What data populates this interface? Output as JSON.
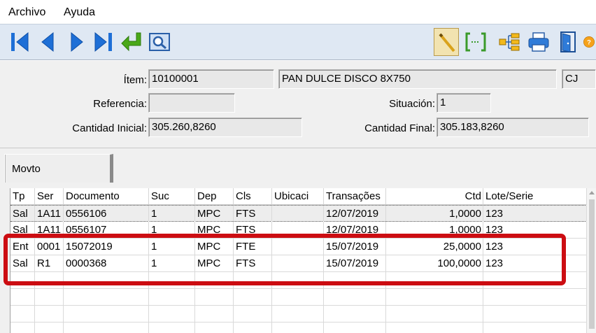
{
  "menu": {
    "archivo": "Archivo",
    "ayuda": "Ayuda"
  },
  "toolbar": {
    "buttons": [
      "first-record",
      "previous-record",
      "next-record",
      "last-record",
      "return",
      "preview",
      "pencil",
      "select-range",
      "hierarchy",
      "print",
      "exit",
      "help"
    ],
    "colors": {
      "nav_blue": "#1e6fd6",
      "return_green": "#4aa819",
      "pressed_bg": "#f2e3b0"
    }
  },
  "form": {
    "item_label": "Ítem:",
    "item_code": "10100001",
    "item_desc": "PAN DULCE DISCO 8X750",
    "item_unit": "CJ",
    "referencia_label": "Referencia:",
    "referencia_value": "",
    "situacion_label": "Situación:",
    "situacion_value": "1",
    "cantidad_inicial_label": "Cantidad Inicial:",
    "cantidad_inicial_value": "305.260,8260",
    "cantidad_final_label": "Cantidad Final:",
    "cantidad_final_value": "305.183,8260"
  },
  "tabs": [
    {
      "label": "Movto"
    }
  ],
  "grid": {
    "headers": [
      "Tp",
      "Ser",
      "Documento",
      "Suc",
      "Dep",
      "Cls",
      "Ubicaci",
      "Transações",
      "Ctd",
      "Lote/Serie"
    ],
    "rows": [
      [
        "Sal",
        "1A11",
        "0556106",
        "1",
        "MPC",
        "FTS",
        "",
        "12/07/2019",
        "1,0000",
        "123"
      ],
      [
        "Sal",
        "1A11",
        "0556107",
        "1",
        "MPC",
        "FTS",
        "",
        "12/07/2019",
        "1,0000",
        "123"
      ],
      [
        "Ent",
        "0001",
        "15072019",
        "1",
        "MPC",
        "FTE",
        "",
        "15/07/2019",
        "25,0000",
        "123"
      ],
      [
        "Sal",
        "R1",
        "0000368",
        "1",
        "MPC",
        "FTS",
        "",
        "15/07/2019",
        "100,0000",
        "123"
      ],
      [
        "",
        "",
        "",
        "",
        "",
        "",
        "",
        "",
        "",
        ""
      ],
      [
        "",
        "",
        "",
        "",
        "",
        "",
        "",
        "",
        "",
        ""
      ],
      [
        "",
        "",
        "",
        "",
        "",
        "",
        "",
        "",
        "",
        ""
      ],
      [
        "",
        "",
        "",
        "",
        "",
        "",
        "",
        "",
        "",
        ""
      ]
    ],
    "selected_row": 0,
    "highlight_color": "#cc0d12"
  }
}
